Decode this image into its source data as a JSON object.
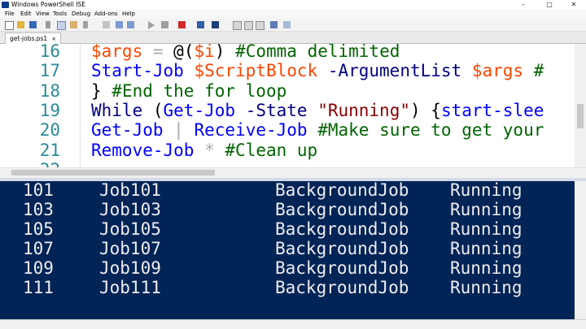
{
  "window": {
    "title": "Windows PowerShell ISE",
    "minimize": "–",
    "maximize": "□",
    "close": "✕"
  },
  "menu": [
    "File",
    "Edit",
    "View",
    "Tools",
    "Debug",
    "Add-ons",
    "Help"
  ],
  "tab": {
    "label": "get-jobs.ps1",
    "close": "×"
  },
  "editor": {
    "lines": [
      {
        "num": "16",
        "tokens": [
          {
            "t": "$args",
            "c": "var"
          },
          {
            "t": " ",
            "c": "txt"
          },
          {
            "t": "=",
            "c": "op"
          },
          {
            "t": " @(",
            "c": "txt"
          },
          {
            "t": "$i",
            "c": "var"
          },
          {
            "t": ") ",
            "c": "txt"
          },
          {
            "t": "#Comma delimited",
            "c": "cmt"
          }
        ]
      },
      {
        "num": "17",
        "tokens": [
          {
            "t": "Start-Job",
            "c": "cmd"
          },
          {
            "t": " ",
            "c": "txt"
          },
          {
            "t": "$ScriptBlock",
            "c": "var"
          },
          {
            "t": " ",
            "c": "txt"
          },
          {
            "t": "-ArgumentList",
            "c": "param"
          },
          {
            "t": " ",
            "c": "txt"
          },
          {
            "t": "$args",
            "c": "var"
          },
          {
            "t": " #",
            "c": "cmt"
          }
        ]
      },
      {
        "num": "18",
        "tokens": [
          {
            "t": "} ",
            "c": "txt"
          },
          {
            "t": "#End the for loop",
            "c": "cmt"
          }
        ]
      },
      {
        "num": "19",
        "tokens": [
          {
            "t": "While",
            "c": "param"
          },
          {
            "t": " (",
            "c": "txt"
          },
          {
            "t": "Get-Job",
            "c": "cmd"
          },
          {
            "t": " ",
            "c": "txt"
          },
          {
            "t": "-State",
            "c": "param"
          },
          {
            "t": " ",
            "c": "txt"
          },
          {
            "t": "\"Running\"",
            "c": "str"
          },
          {
            "t": ") {",
            "c": "txt"
          },
          {
            "t": "start-slee",
            "c": "cmd"
          }
        ]
      },
      {
        "num": "20",
        "tokens": [
          {
            "t": "Get-Job",
            "c": "cmd"
          },
          {
            "t": " ",
            "c": "txt"
          },
          {
            "t": "|",
            "c": "op"
          },
          {
            "t": " ",
            "c": "txt"
          },
          {
            "t": "Receive-Job",
            "c": "cmd"
          },
          {
            "t": " ",
            "c": "txt"
          },
          {
            "t": "#Make sure to get your",
            "c": "cmt"
          }
        ]
      },
      {
        "num": "21",
        "tokens": [
          {
            "t": "Remove-Job",
            "c": "cmd"
          },
          {
            "t": " ",
            "c": "txt"
          },
          {
            "t": "*",
            "c": "op"
          },
          {
            "t": " ",
            "c": "txt"
          },
          {
            "t": "#Clean up",
            "c": "cmt"
          }
        ]
      },
      {
        "num": "22",
        "tokens": []
      }
    ]
  },
  "console": {
    "rows": [
      {
        "id": "101",
        "name": "Job101",
        "type": "BackgroundJob",
        "state": "Running"
      },
      {
        "id": "103",
        "name": "Job103",
        "type": "BackgroundJob",
        "state": "Running"
      },
      {
        "id": "105",
        "name": "Job105",
        "type": "BackgroundJob",
        "state": "Running"
      },
      {
        "id": "107",
        "name": "Job107",
        "type": "BackgroundJob",
        "state": "Running"
      },
      {
        "id": "109",
        "name": "Job109",
        "type": "BackgroundJob",
        "state": "Running"
      },
      {
        "id": "111",
        "name": "Job111",
        "type": "BackgroundJob",
        "state": "Running"
      }
    ]
  },
  "colors": {
    "console_bg": "#012456",
    "console_fg": "#eeedf0",
    "variable": "#ff4500",
    "cmdlet": "#0000ff",
    "comment": "#006400",
    "parameter": "#000080",
    "string": "#8b0000"
  }
}
